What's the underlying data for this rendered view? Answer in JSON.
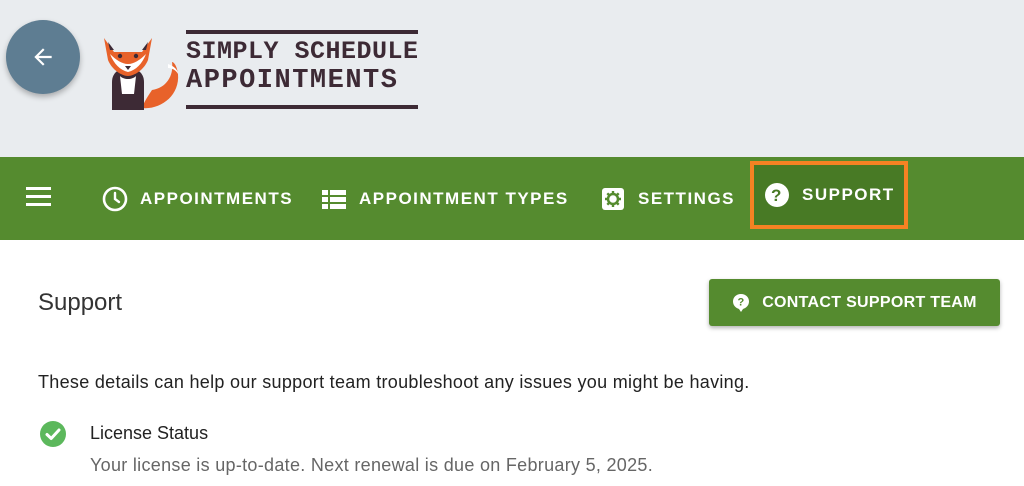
{
  "header": {
    "logo": {
      "line1": "SIMPLY SCHEDULE",
      "line2": "APPOINTMENTS"
    },
    "back_icon": "arrow-left-icon"
  },
  "nav": {
    "items": [
      {
        "label": "APPOINTMENTS",
        "icon": "clock-icon"
      },
      {
        "label": "APPOINTMENT TYPES",
        "icon": "list-icon"
      },
      {
        "label": "SETTINGS",
        "icon": "gear-icon"
      },
      {
        "label": "SUPPORT",
        "icon": "help-circle-icon",
        "highlighted": true
      }
    ],
    "highlight_color": "#f58223",
    "background_color": "#558b2f"
  },
  "main": {
    "title": "Support",
    "contact_button": {
      "label": "CONTACT SUPPORT TEAM",
      "icon": "help-bubble-icon"
    },
    "intro": "These details can help our support team troubleshoot any issues you might be having.",
    "license": {
      "title": "License Status",
      "description": "Your license is up-to-date. Next renewal is due on February 5, 2025.",
      "icon": "check-circle-icon",
      "status_color": "#5cb85c"
    }
  }
}
